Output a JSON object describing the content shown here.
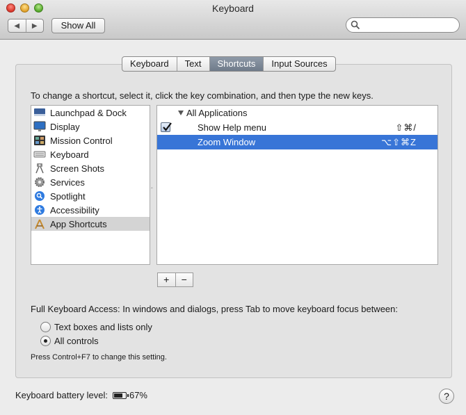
{
  "window": {
    "title": "Keyboard",
    "back_glyph": "◀",
    "forward_glyph": "▶",
    "show_all_label": "Show All",
    "search_placeholder": ""
  },
  "tabs": [
    {
      "label": "Keyboard",
      "selected": false
    },
    {
      "label": "Text",
      "selected": false
    },
    {
      "label": "Shortcuts",
      "selected": true
    },
    {
      "label": "Input Sources",
      "selected": false
    }
  ],
  "instructions": "To change a shortcut, select it, click the key combination, and then type the new keys.",
  "categories": [
    {
      "label": "Launchpad & Dock",
      "icon": "launchpad-dock-icon"
    },
    {
      "label": "Display",
      "icon": "display-icon"
    },
    {
      "label": "Mission Control",
      "icon": "mission-control-icon"
    },
    {
      "label": "Keyboard",
      "icon": "keyboard-icon"
    },
    {
      "label": "Screen Shots",
      "icon": "screenshot-icon"
    },
    {
      "label": "Services",
      "icon": "gear-icon"
    },
    {
      "label": "Spotlight",
      "icon": "spotlight-icon"
    },
    {
      "label": "Accessibility",
      "icon": "accessibility-icon"
    },
    {
      "label": "App Shortcuts",
      "icon": "app-shortcuts-icon",
      "selected": true
    }
  ],
  "shortcuts": {
    "group_label": "All Applications",
    "items": [
      {
        "name": "Show Help menu",
        "keys": "⇧⌘/",
        "checked": true,
        "selected": false
      },
      {
        "name": "Zoom Window",
        "keys": "⌥⇧⌘Z",
        "checked": false,
        "selected": true
      }
    ]
  },
  "buttons": {
    "add": "+",
    "remove": "−"
  },
  "full_keyboard_access": {
    "label": "Full Keyboard Access: In windows and dialogs, press Tab to move keyboard focus between:",
    "options": [
      {
        "label": "Text boxes and lists only",
        "selected": false
      },
      {
        "label": "All controls",
        "selected": true
      }
    ],
    "hint": "Press Control+F7 to change this setting."
  },
  "battery": {
    "label": "Keyboard battery level:",
    "value": "67%",
    "level": 0.67
  },
  "help_label": "?",
  "colors": {
    "selection": "#3875d7",
    "tab_selected": "#7b8696"
  }
}
